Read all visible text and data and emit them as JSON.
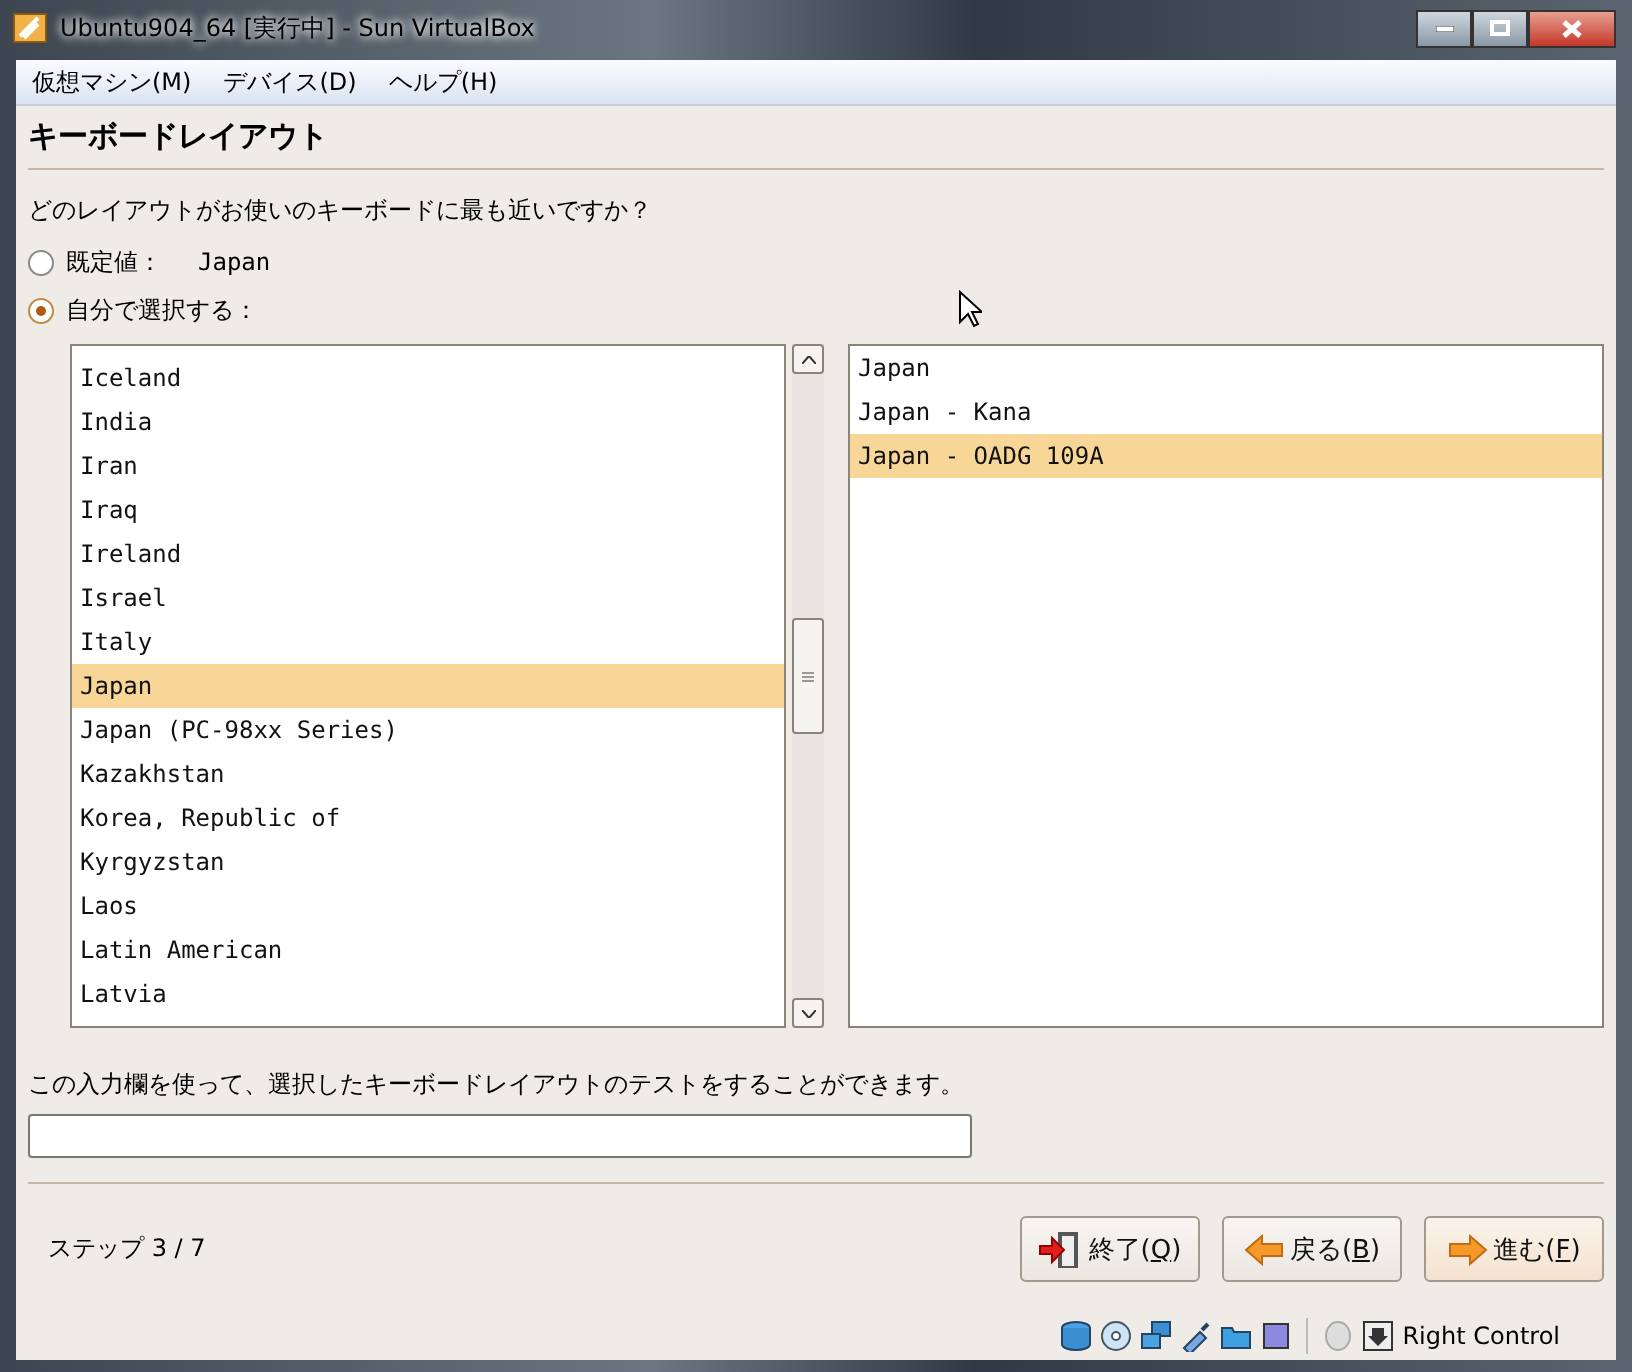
{
  "window": {
    "title": "Ubuntu904_64 [実行中] - Sun VirtualBox"
  },
  "menu": [
    "仮想マシン(M)",
    "デバイス(D)",
    "ヘルプ(H)"
  ],
  "page_title": "キーボードレイアウト",
  "question": "どのレイアウトがお使いのキーボードに最も近いですか？",
  "options": [
    {
      "label": "既定値：",
      "value": "Japan",
      "selected": false
    },
    {
      "label": "自分で選択する：",
      "selected": true
    }
  ],
  "layouts": [
    {
      "label": "Iceland",
      "selected": false
    },
    {
      "label": "India",
      "selected": false
    },
    {
      "label": "Iran",
      "selected": false
    },
    {
      "label": "Iraq",
      "selected": false
    },
    {
      "label": "Ireland",
      "selected": false
    },
    {
      "label": "Israel",
      "selected": false
    },
    {
      "label": "Italy",
      "selected": false
    },
    {
      "label": "Japan",
      "selected": true
    },
    {
      "label": "Japan (PC-98xx Series)",
      "selected": false
    },
    {
      "label": "Kazakhstan",
      "selected": false
    },
    {
      "label": "Korea, Republic of",
      "selected": false
    },
    {
      "label": "Kyrgyzstan",
      "selected": false
    },
    {
      "label": "Laos",
      "selected": false
    },
    {
      "label": "Latin American",
      "selected": false
    },
    {
      "label": "Latvia",
      "selected": false
    }
  ],
  "variants": [
    {
      "label": "Japan",
      "selected": false
    },
    {
      "label": "Japan - Kana",
      "selected": false
    },
    {
      "label": "Japan - OADG 109A",
      "selected": true
    }
  ],
  "test_hint": "この入力欄を使って、選択したキーボードレイアウトのテストをすることができます。",
  "step": "ステップ 3 / 7",
  "buttons": [
    {
      "kind": "quit",
      "label": "終了(**Q**)"
    },
    {
      "kind": "back",
      "label": "戻る(**B**)"
    },
    {
      "kind": "forward",
      "label": "進む(**F**)"
    }
  ],
  "status_bar": {
    "host_key": "Right Control"
  }
}
